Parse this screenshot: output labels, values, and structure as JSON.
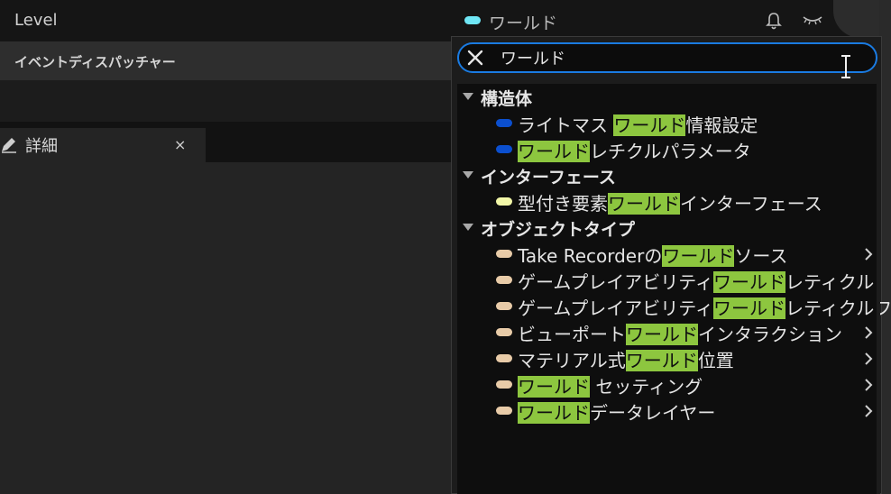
{
  "top": {
    "level_label": "Level",
    "variable_name": "ワールド",
    "variable_color": "#6fe6f5"
  },
  "left": {
    "event_dispatchers_label": "イベントディスパッチャー",
    "details_tab_label": "詳細",
    "details_close": "×"
  },
  "search": {
    "query": "ワールド",
    "focus_color": "#1a7be2"
  },
  "highlight_color": "#8dc63f",
  "categories": [
    {
      "label": "構造体",
      "items": [
        {
          "pre": "ライトマス ",
          "hl": "ワールド",
          "post": "情報設定",
          "pill_color": "#0b4fcf",
          "has_submenu": false
        },
        {
          "pre": "",
          "hl": "ワールド",
          "post": "レチクルパラメータ",
          "pill_color": "#0b4fcf",
          "has_submenu": false
        }
      ]
    },
    {
      "label": "インターフェース",
      "items": [
        {
          "pre": "型付き要素",
          "hl": "ワールド",
          "post": "インターフェース",
          "pill_color": "#f2f7a8",
          "has_submenu": false
        }
      ]
    },
    {
      "label": "オブジェクトタイプ",
      "items": [
        {
          "pre": "Take Recorderの",
          "hl": "ワールド",
          "post": "ソース",
          "pill_color": "#e8cba8",
          "has_submenu": true
        },
        {
          "pre": "ゲームプレイアビリティ",
          "hl": "ワールド",
          "post": "レティクル",
          "pill_color": "#e8cba8",
          "has_submenu": false
        },
        {
          "pre": "ゲームプレイアビリティ",
          "hl": "ワールド",
          "post": "レティクルフ",
          "pill_color": "#e8cba8",
          "has_submenu": false
        },
        {
          "pre": "ビューポート",
          "hl": "ワールド",
          "post": "インタラクション",
          "pill_color": "#e8cba8",
          "has_submenu": true
        },
        {
          "pre": "マテリアル式",
          "hl": "ワールド",
          "post": "位置",
          "pill_color": "#e8cba8",
          "has_submenu": true
        },
        {
          "pre": "",
          "hl": "ワールド",
          "post": " セッティング",
          "pill_color": "#e8cba8",
          "has_submenu": true
        },
        {
          "pre": "",
          "hl": "ワールド",
          "post": "データレイヤー",
          "pill_color": "#e8cba8",
          "has_submenu": true
        }
      ]
    }
  ]
}
